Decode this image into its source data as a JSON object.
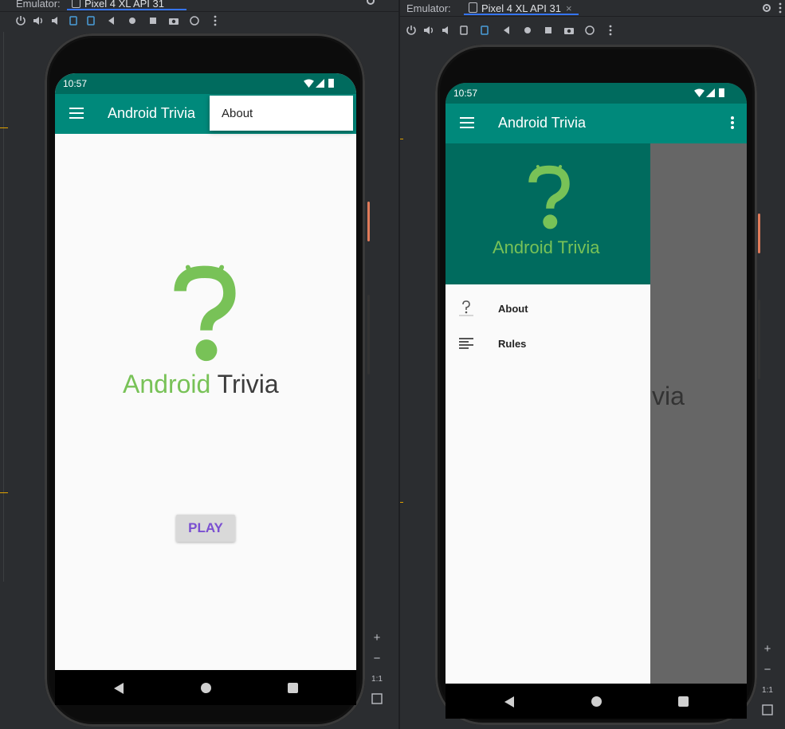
{
  "left_panel": {
    "tab_label": "Emulator:",
    "device_tab": "Pixel 4 XL API 31",
    "status_time": "10:57",
    "app_title": "Android Trivia",
    "menu_popup_item": "About",
    "logo_word_android": "Android",
    "logo_word_trivia": "Trivia",
    "play_button": "PLAY",
    "zoom": {
      "plus": "+",
      "minus": "−",
      "ratio": "1:1"
    }
  },
  "right_panel": {
    "tab_label": "Emulator:",
    "device_tab": "Pixel 4 XL API 31",
    "tab_close": "×",
    "status_time": "10:57",
    "app_title": "Android Trivia",
    "drawer_header_title": "Android Trivia",
    "drawer_items": [
      {
        "label": "About",
        "icon": "trivia-logo-icon"
      },
      {
        "label": "Rules",
        "icon": "rules-list-icon"
      }
    ],
    "background_partial_text": "via",
    "zoom": {
      "plus": "+",
      "minus": "−",
      "ratio": "1:1"
    }
  },
  "colors": {
    "status_bar": "#006b5e",
    "app_bar": "#00897b",
    "android_green": "#78c257",
    "play_text": "#7a4fd1",
    "ide_background": "#2b2d30",
    "tab_accent": "#3574f0"
  },
  "toolbar_icons": [
    "power-icon",
    "volume-up-icon",
    "volume-down-icon",
    "rotate-left-icon",
    "rotate-right-icon",
    "back-icon",
    "home-icon",
    "overview-icon",
    "screenshot-icon",
    "snapshot-icon",
    "more-icon"
  ]
}
